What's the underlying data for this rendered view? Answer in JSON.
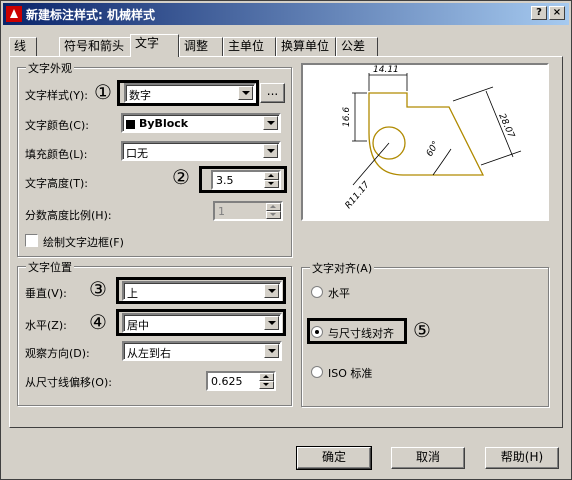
{
  "title": "新建标注样式: 机械样式",
  "tabs": [
    {
      "label": "线"
    },
    {
      "label": "符号和箭头"
    },
    {
      "label": "文字"
    },
    {
      "label": "调整"
    },
    {
      "label": "主单位"
    },
    {
      "label": "换算单位"
    },
    {
      "label": "公差"
    }
  ],
  "appearance": {
    "title": "文字外观",
    "style_label": "文字样式(Y):",
    "style_value": "数字",
    "browse_label": "...",
    "color_label": "文字颜色(C):",
    "color_value": "ByBlock",
    "fill_label": "填充颜色(L):",
    "fill_value": "口无",
    "height_label": "文字高度(T):",
    "height_value": "3.5",
    "fraction_label": "分数高度比例(H):",
    "fraction_value": "1",
    "frame_label": "绘制文字边框(F)"
  },
  "placement": {
    "title": "文字位置",
    "vertical_label": "垂直(V):",
    "vertical_value": "上",
    "horizontal_label": "水平(Z):",
    "horizontal_value": "居中",
    "view_label": "观察方向(D):",
    "view_value": "从左到右",
    "offset_label": "从尺寸线偏移(O):",
    "offset_value": "0.625"
  },
  "alignment": {
    "title": "文字对齐(A)",
    "opt1": "水平",
    "opt2": "与尺寸线对齐",
    "opt3": "ISO 标准"
  },
  "markers": [
    "①",
    "②",
    "③",
    "④",
    "⑤"
  ],
  "preview": {
    "d1": "14.11",
    "d2": "16.6",
    "d3": "28.07",
    "d4": "60°",
    "d5": "R11.17"
  },
  "buttons": {
    "ok": "确定",
    "cancel": "取消",
    "help": "帮助(H)"
  },
  "title_buttons": {
    "help": "?",
    "close": "×"
  }
}
